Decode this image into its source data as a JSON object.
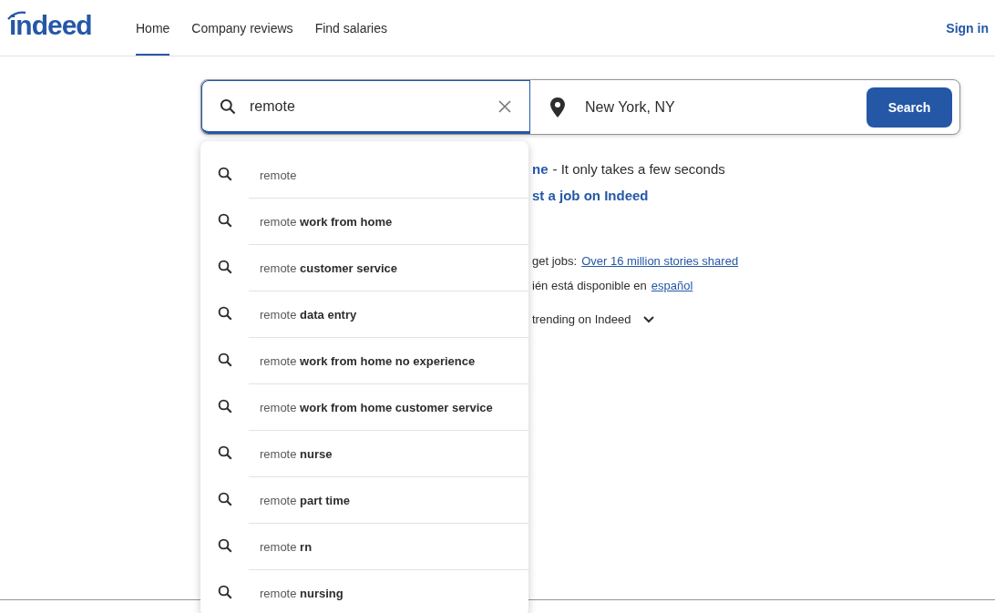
{
  "logo": "indeed",
  "nav": [
    {
      "label": "Home",
      "selected": true
    },
    {
      "label": "Company reviews",
      "selected": false
    },
    {
      "label": "Find salaries",
      "selected": false
    }
  ],
  "sign_in": "Sign in",
  "search": {
    "what": "remote",
    "where": "New York, NY",
    "button": "Search"
  },
  "suggestions": [
    "remote",
    "remote **work from home**",
    "remote **customer service**",
    "remote **data entry**",
    "remote **work from home no experience**",
    "remote **work from home customer service**",
    "remote **nurse**",
    "remote **part time**",
    "remote **rn**",
    "remote **nursing**"
  ],
  "promo": {
    "link_1": "ne",
    "text_1": "- It only takes a few seconds",
    "link_2": "st a job on Indeed"
  },
  "stories": {
    "text": "get jobs:",
    "link": "Over 16 million stories shared"
  },
  "language": {
    "text": "ién está disponible en",
    "link": "español"
  },
  "trending": {
    "text": "trending on Indeed",
    "expanded": false
  }
}
